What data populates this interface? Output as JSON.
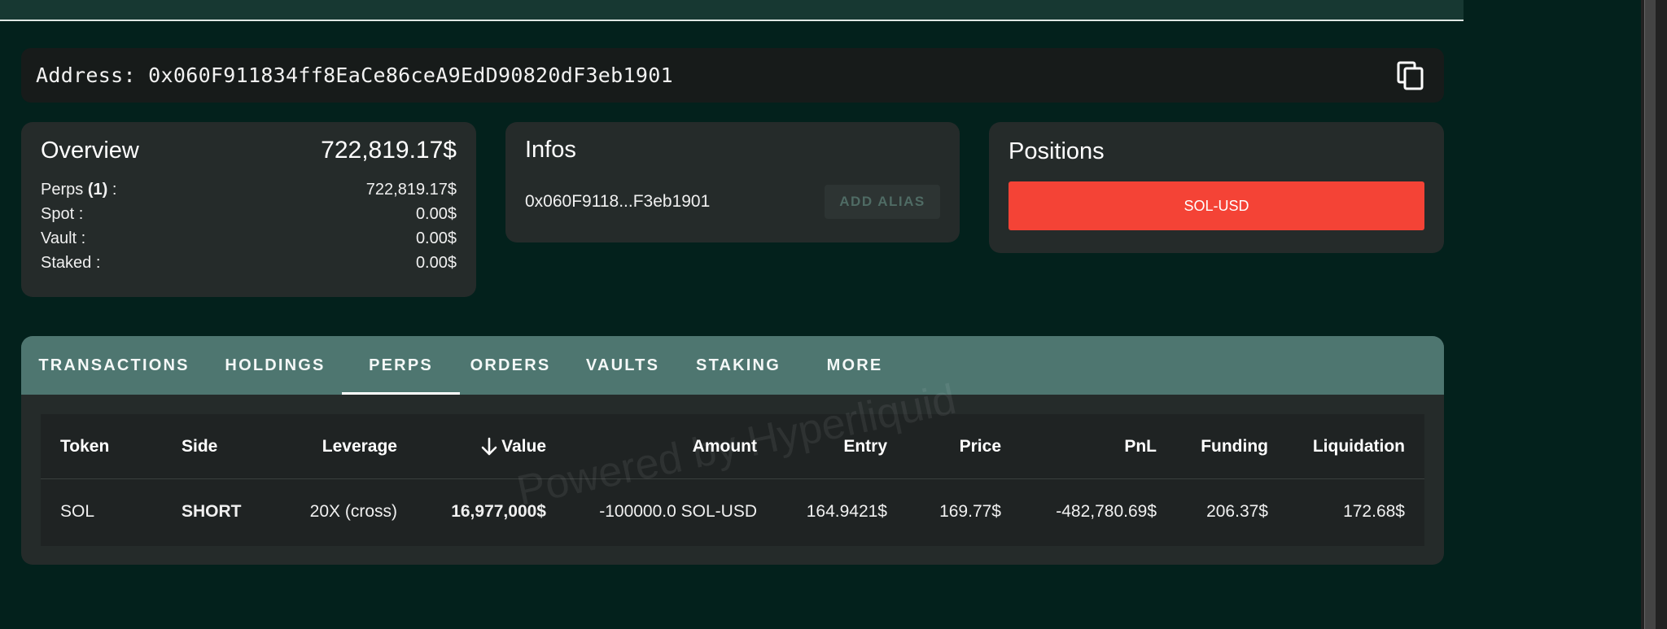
{
  "address_bar": {
    "text": "Address: 0x060F911834ff8EaCe86ceA9EdD90820dF3eb1901",
    "copy_icon": "copy-icon"
  },
  "overview": {
    "title": "Overview",
    "total": "722,819.17$",
    "rows": [
      {
        "label_pre": "Perps ",
        "label_bold": "(1)",
        "label_post": " :",
        "value": "722,819.17$"
      },
      {
        "label": "Spot :",
        "value": "0.00$"
      },
      {
        "label": "Vault :",
        "value": "0.00$"
      },
      {
        "label": "Staked :",
        "value": "0.00$"
      }
    ]
  },
  "infos": {
    "title": "Infos",
    "address_short": "0x060F9118...F3eb1901",
    "alias_button": "ADD ALIAS"
  },
  "positions": {
    "title": "Positions",
    "items": [
      "SOL-USD"
    ],
    "button_color": "#f44336"
  },
  "tabs": [
    "TRANSACTIONS",
    "HOLDINGS",
    "PERPS",
    "ORDERS",
    "VAULTS",
    "STAKING",
    "MORE"
  ],
  "active_tab": "PERPS",
  "table": {
    "headers": [
      "Token",
      "Side",
      "Leverage",
      "Value",
      "Amount",
      "Entry",
      "Price",
      "PnL",
      "Funding",
      "Liquidation"
    ],
    "sort_icon": "arrow-down-icon",
    "rows": [
      [
        "SOL",
        "SHORT",
        "20X (cross)",
        "16,977,000$",
        "-100000.0 SOL-USD",
        "164.9421$",
        "169.77$",
        "-482,780.69$",
        "206.37$",
        "172.68$"
      ]
    ]
  },
  "watermark": "Powered by Hyperliquid",
  "colors": {
    "background": "#03211c",
    "short": "#e52b2b",
    "positive": "#2e8b2e",
    "tabbar": "#4e7670"
  }
}
